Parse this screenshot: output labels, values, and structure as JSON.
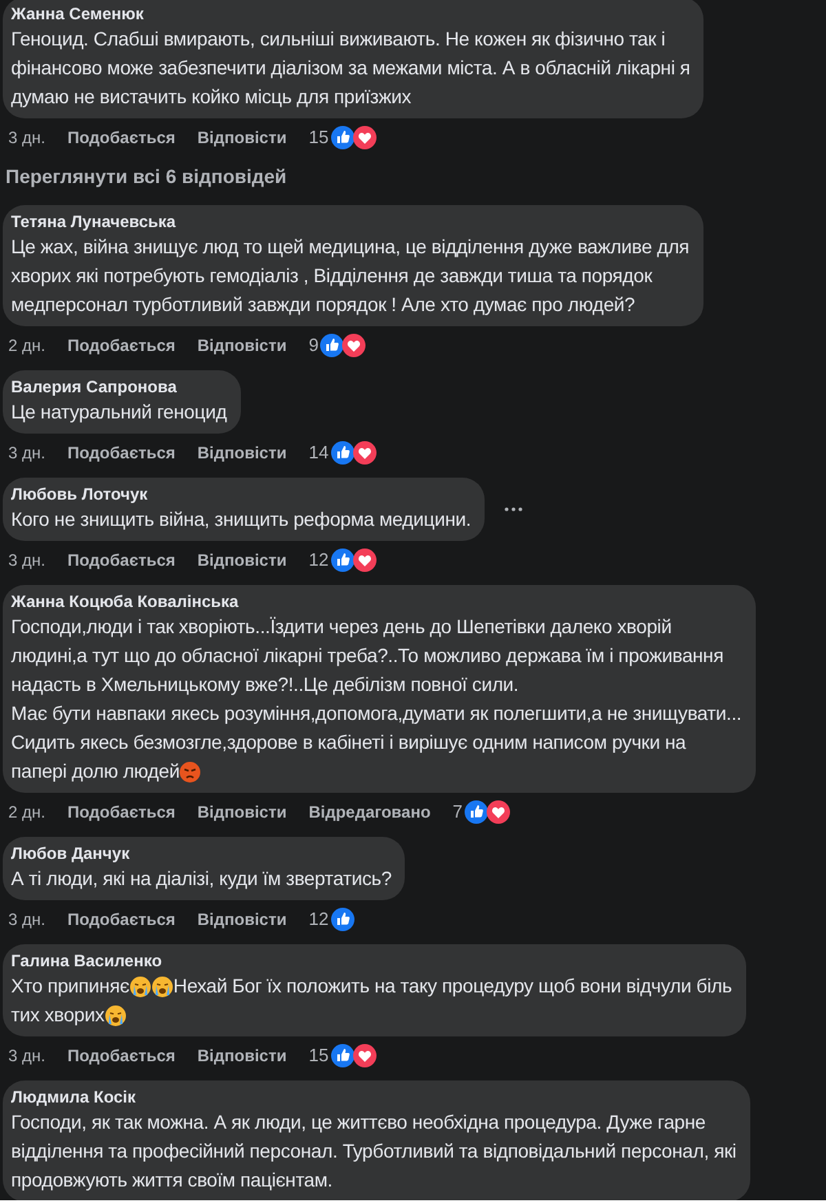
{
  "comments": [
    {
      "author": "Жанна Семенюк",
      "lines": [
        [
          {
            "kind": "text",
            "text": "Геноцид. Слабші вмирають, сильніші виживають. Не кожен як фізично так і"
          }
        ],
        [
          {
            "kind": "text",
            "text": "фінансово може забезпечити діалізом за межами міста. А в обласній лікарні я"
          }
        ],
        [
          {
            "kind": "text",
            "text": "думаю не вистачить койко місць для приїзжих"
          }
        ]
      ],
      "time": "3 дн.",
      "like": "Подобається",
      "reply": "Відповісти",
      "count": "15",
      "love": true,
      "menu_shown": false
    },
    {
      "kind": "link",
      "text": "Переглянути всі 6 відповідей"
    },
    {
      "author": "Тетяна Луначевська",
      "lines": [
        [
          {
            "kind": "text",
            "text": "Це жах, війна знищує люд то щей медицина, це відділення дуже важливе для"
          }
        ],
        [
          {
            "kind": "text",
            "text": "хворих які потребують гемодіаліз , Відділення де завжди тиша та порядок"
          }
        ],
        [
          {
            "kind": "text",
            "text": "медперсонал турботливий завжди порядок ! Але хто думає про людей?"
          }
        ]
      ],
      "time": "2 дн.",
      "like": "Подобається",
      "reply": "Відповісти",
      "count": "9",
      "love": true,
      "menu_shown": false
    },
    {
      "author": "Валерия Сапронова",
      "lines": [
        [
          {
            "kind": "text",
            "text": "Це натуральний геноцид"
          }
        ]
      ],
      "time": "3 дн.",
      "like": "Подобається",
      "reply": "Відповісти",
      "count": "14",
      "love": true,
      "menu_shown": false
    },
    {
      "author": "Любовь Лоточук",
      "lines": [
        [
          {
            "kind": "text",
            "text": "Кого не знищить війна, знищить реформа медицини."
          }
        ]
      ],
      "time": "3 дн.",
      "like": "Подобається",
      "reply": "Відповісти",
      "count": "12",
      "love": true,
      "menu_shown": true
    },
    {
      "author": "Жанна Коцюба Ковалінська",
      "lines": [
        [
          {
            "kind": "text",
            "text": "Господи,люди і так хворіють...Їздити через день до Шепетівки далеко хворій"
          }
        ],
        [
          {
            "kind": "text",
            "text": "людині,а тут що до обласної лікарні треба?..То можливо держава їм і проживання"
          }
        ],
        [
          {
            "kind": "text",
            "text": "надасть в Хмельницькому вже?!..Це дебілізм повної сили."
          }
        ],
        [
          {
            "kind": "text",
            "text": "Має бути навпаки якесь розуміння,допомога,думати як полегшити,а не знищувати..."
          }
        ],
        [
          {
            "kind": "text",
            "text": "Сидить якесь безмозгле,здорове в кабінеті і вирішує одним написом ручки на"
          }
        ],
        [
          {
            "kind": "text",
            "text": "папері долю людей"
          },
          {
            "kind": "angry"
          }
        ]
      ],
      "time": "2 дн.",
      "like": "Подобається",
      "reply": "Відповісти",
      "edited": "Відредаговано",
      "count": "7",
      "love": true,
      "menu_shown": false
    },
    {
      "author": "Любов Данчук",
      "lines": [
        [
          {
            "kind": "text",
            "text": "А ті люди, які на діалізі, куди їм звертатись?"
          }
        ]
      ],
      "time": "3 дн.",
      "like": "Подобається",
      "reply": "Відповісти",
      "count": "12",
      "love": false,
      "menu_shown": false
    },
    {
      "author": "Галина Василенко",
      "lines": [
        [
          {
            "kind": "text",
            "text": "Хто припиняє"
          },
          {
            "kind": "cry"
          },
          {
            "kind": "cry"
          },
          {
            "kind": "text",
            "text": "Нехай Бог їх положить на таку процедуру щоб вони відчули біль"
          }
        ],
        [
          {
            "kind": "text",
            "text": "тих хворих"
          },
          {
            "kind": "cry"
          }
        ]
      ],
      "time": "3 дн.",
      "like": "Подобається",
      "reply": "Відповісти",
      "count": "15",
      "love": true,
      "menu_shown": false
    },
    {
      "author": "Людмила Косік",
      "lines": [
        [
          {
            "kind": "text",
            "text": "Господи, як так можна. А як люди, це життєво необхідна процедура. Дуже гарне"
          }
        ],
        [
          {
            "kind": "text",
            "text": "відділення та професійний персонал. Турботливий та відповідальний персонал, які"
          }
        ],
        [
          {
            "kind": "text",
            "text": "продовжують життя своїм пацієнтам."
          }
        ]
      ],
      "menu_shown": false
    }
  ]
}
